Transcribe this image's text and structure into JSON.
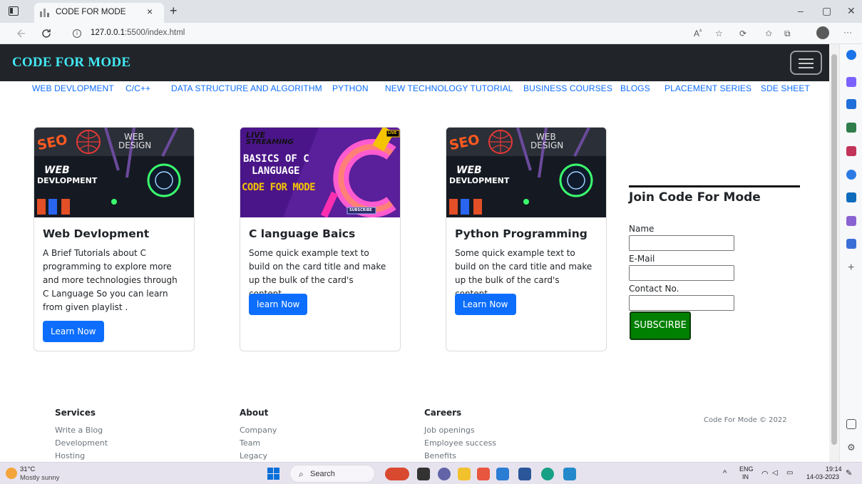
{
  "browser": {
    "tab_title": "CODE FOR MODE",
    "tab_close": "×",
    "new_tab": "+",
    "url_host": "127.0.0.1",
    "url_rest": ":5500/index.html",
    "window_controls": [
      "–",
      "▢",
      "✕"
    ],
    "menu": "···"
  },
  "navbar": {
    "brand": "CODE FOR MODE"
  },
  "subnav": {
    "links": [
      "WEB DEVLOPMENT",
      "C/C++",
      "DATA STRUCTURE AND ALGORITHM",
      "PYTHON",
      "NEW TECHNOLOGY TUTORIAL",
      "BUSINESS COURSES",
      "BLOGS",
      "PLACEMENT SERIES",
      "SDE SHEET"
    ]
  },
  "cards": [
    {
      "title": "Web Devlopment",
      "text": "A Brief Tutorials about C programming to explore more and more technologies through C Language So you can learn from given playlist .",
      "button": "Learn Now",
      "thumb": {
        "line1": "WEB",
        "line2": "DESIGN",
        "big1": "WEB",
        "big2": "DEVLOPMENT",
        "seo": "SEO"
      }
    },
    {
      "title": "C language Baics",
      "text": "Some quick example text to build on the card title and make up the bulk of the card's content.",
      "button": "learn Now",
      "thumb": {
        "live1": "LIVE",
        "live2": "STREAMING",
        "head1": "BASICS OF C",
        "head2": "LANGUAGE",
        "brand": "CODE FOR MODE",
        "badge": "SUBSCRIBE",
        "live_tag": "LIVE"
      }
    },
    {
      "title": "Python Programming",
      "text": "Some quick example text to build on the card title and make up the bulk of the card's content.",
      "button": "Learn Now",
      "thumb": {
        "line1": "WEB",
        "line2": "DESIGN",
        "big1": "WEB",
        "big2": "DEVLOPMENT",
        "seo": "SEO"
      }
    }
  ],
  "join": {
    "title": "Join Code For Mode",
    "name_label": "Name",
    "email_label": "E-Mail",
    "contact_label": "Contact No.",
    "button": "SUBSCIRBE"
  },
  "footer": {
    "columns": [
      {
        "heading": "Services",
        "links": [
          "Write a Blog",
          "Development",
          "Hosting"
        ]
      },
      {
        "heading": "About",
        "links": [
          "Company",
          "Team",
          "Legacy"
        ]
      },
      {
        "heading": "Careers",
        "links": [
          "Job openings",
          "Employee success",
          "Benefits"
        ]
      }
    ],
    "copyright": "Code For Mode © 2022"
  },
  "taskbar": {
    "temp": "31°C",
    "condition": "Mostly sunny",
    "search": "Search",
    "lang1": "ENG",
    "lang2": "IN",
    "time": "19:14",
    "date": "14-03-2023"
  },
  "colors": {
    "navbar_bg": "#212529",
    "brand": "#42e8f4",
    "link": "#0d6efd",
    "subscribe": "#008000"
  }
}
